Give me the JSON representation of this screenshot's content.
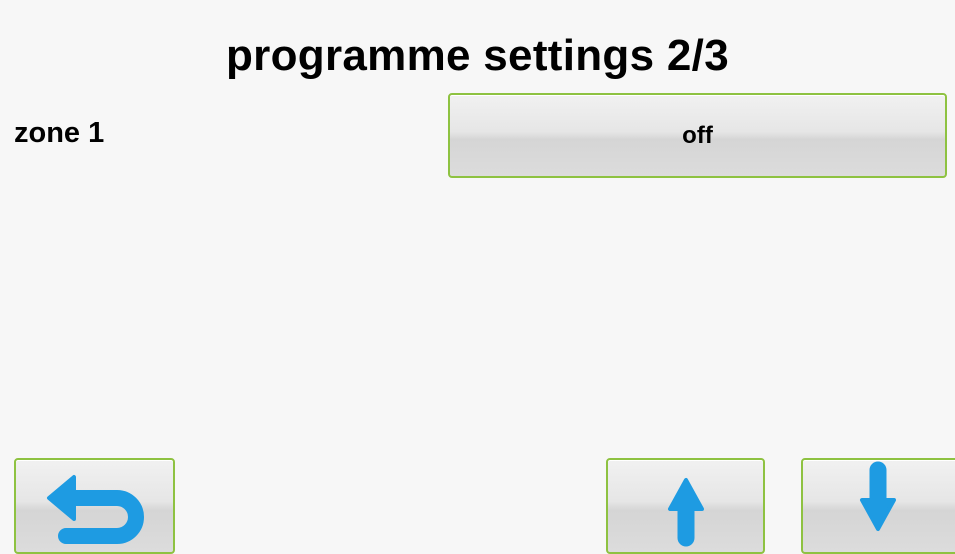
{
  "screen": {
    "title": "programme settings 2/3"
  },
  "settings": [
    {
      "label": "zone 1",
      "value": "off"
    }
  ],
  "nav": {
    "back_icon": "back-arrow-icon",
    "up_icon": "arrow-up-icon",
    "down_icon": "arrow-down-icon"
  },
  "colors": {
    "button_border": "#8ec241",
    "icon_blue": "#1e9be2",
    "background": "#f7f7f7"
  }
}
